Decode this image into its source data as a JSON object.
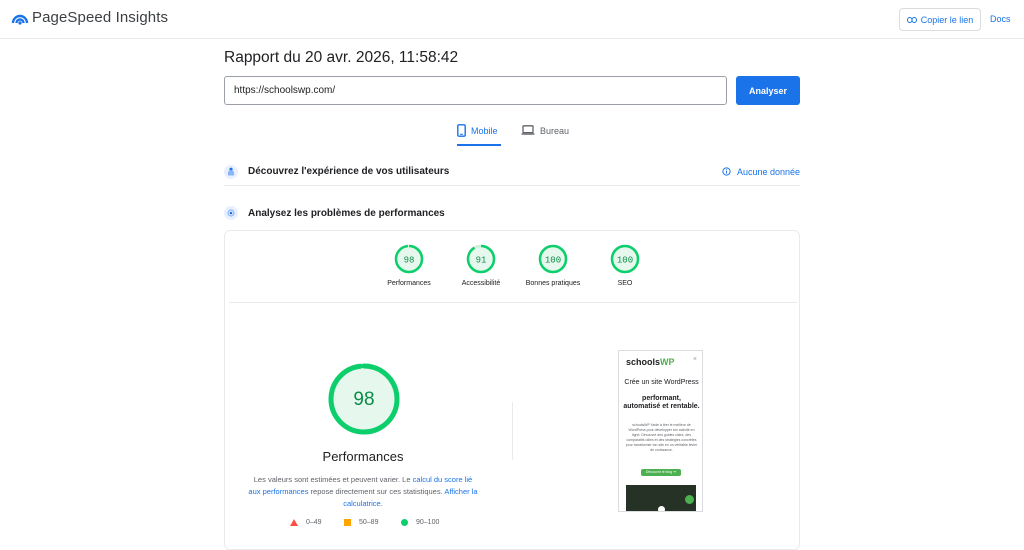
{
  "header": {
    "app_title": "PageSpeed Insights",
    "copy_link_label": "Copier le lien",
    "docs_label": "Docs"
  },
  "report": {
    "title": "Rapport du 20 avr. 2026, 11:58:42",
    "url_value": "https://schoolswp.com/",
    "analyze_label": "Analyser"
  },
  "tabs": [
    {
      "label": "Mobile",
      "active": true
    },
    {
      "label": "Bureau",
      "active": false
    }
  ],
  "sections": {
    "experience_title": "Découvrez l'expérience de vos utilisateurs",
    "no_data_label": "Aucune donnée",
    "performance_title": "Analysez les problèmes de performances"
  },
  "scores": [
    {
      "value": 98,
      "label": "Performances"
    },
    {
      "value": 91,
      "label": "Accessibilité"
    },
    {
      "value": 100,
      "label": "Bonnes pratiques"
    },
    {
      "value": 100,
      "label": "SEO"
    }
  ],
  "main_score": {
    "value": 98,
    "label": "Performances",
    "explain_1": "Les valeurs sont estimées et peuvent varier. Le ",
    "explain_link_1": "calcul du score lié aux performances",
    "explain_2": " repose directement sur ces statistiques. ",
    "explain_link_2": "Afficher la calculatrice."
  },
  "legend": [
    {
      "range": "0–49",
      "color": "#ff4e42"
    },
    {
      "range": "50–89",
      "color": "#ffa400"
    },
    {
      "range": "90–100",
      "color": "#0cce6b"
    }
  ],
  "preview": {
    "logo_prefix": "schools",
    "logo_suffix": "WP",
    "close_glyph": "×",
    "heading_line1": "Crée un site WordPress",
    "heading_line2": "performant, automatisé et rentable.",
    "body_text": "schoolsWP t'aide à tirer le meilleur de WordPress pour développer ton activité en ligne. Découvre des guides clairs, des comparatifs utiles et des stratégies concrètes pour transformer ton site en un véritable levier de croissance.",
    "cta_label": "Découvrir le blog ➔"
  },
  "colors": {
    "accent": "#1a73e8",
    "pass": "#0cce6b",
    "pass_text": "#0c8a46"
  }
}
